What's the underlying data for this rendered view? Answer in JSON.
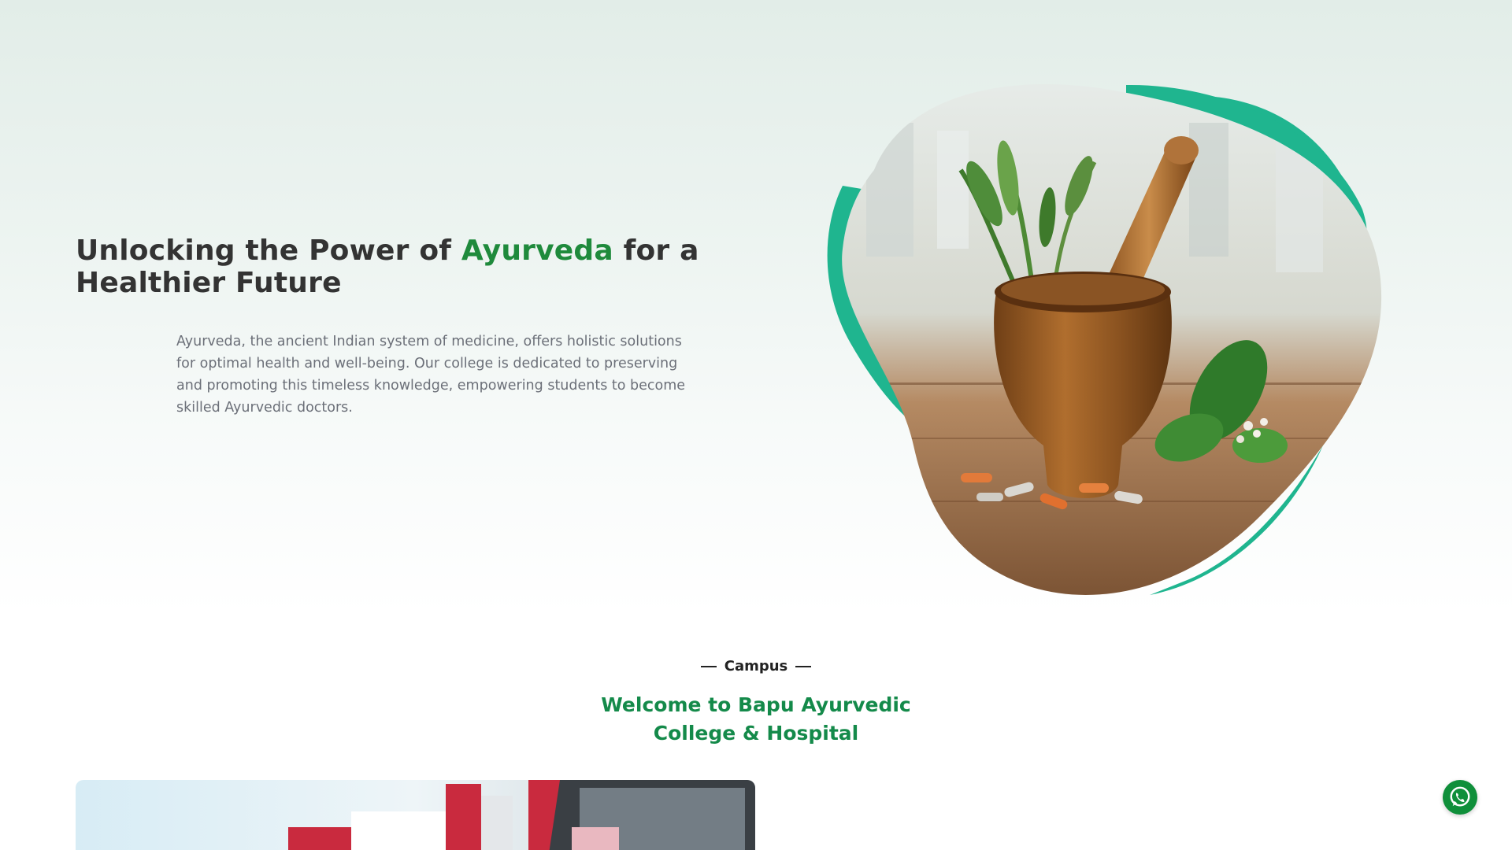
{
  "hero": {
    "title_part1": "Unlocking the Power of ",
    "title_accent": "Ayurveda",
    "title_part2": " for a Healthier Future",
    "description": "Ayurveda, the ancient Indian system of medicine, offers holistic solutions for optimal health and well-being. Our college is dedicated to preserving and promoting this timeless knowledge, empowering students to become skilled Ayurvedic doctors.",
    "image_icon": "mortar-pestle-herbs-image"
  },
  "campus": {
    "label": "Campus",
    "heading_line1": "Welcome to Bapu Ayurvedic",
    "heading_line2": "College & Hospital",
    "photo_icon": "campus-building-image"
  },
  "floating": {
    "whatsapp_icon": "whatsapp-icon"
  },
  "colors": {
    "accent_green": "#1f8a3c",
    "heading_green": "#148a4a",
    "blob_teal": "#1fb58f",
    "whatsapp_green": "#0f8f3a"
  }
}
